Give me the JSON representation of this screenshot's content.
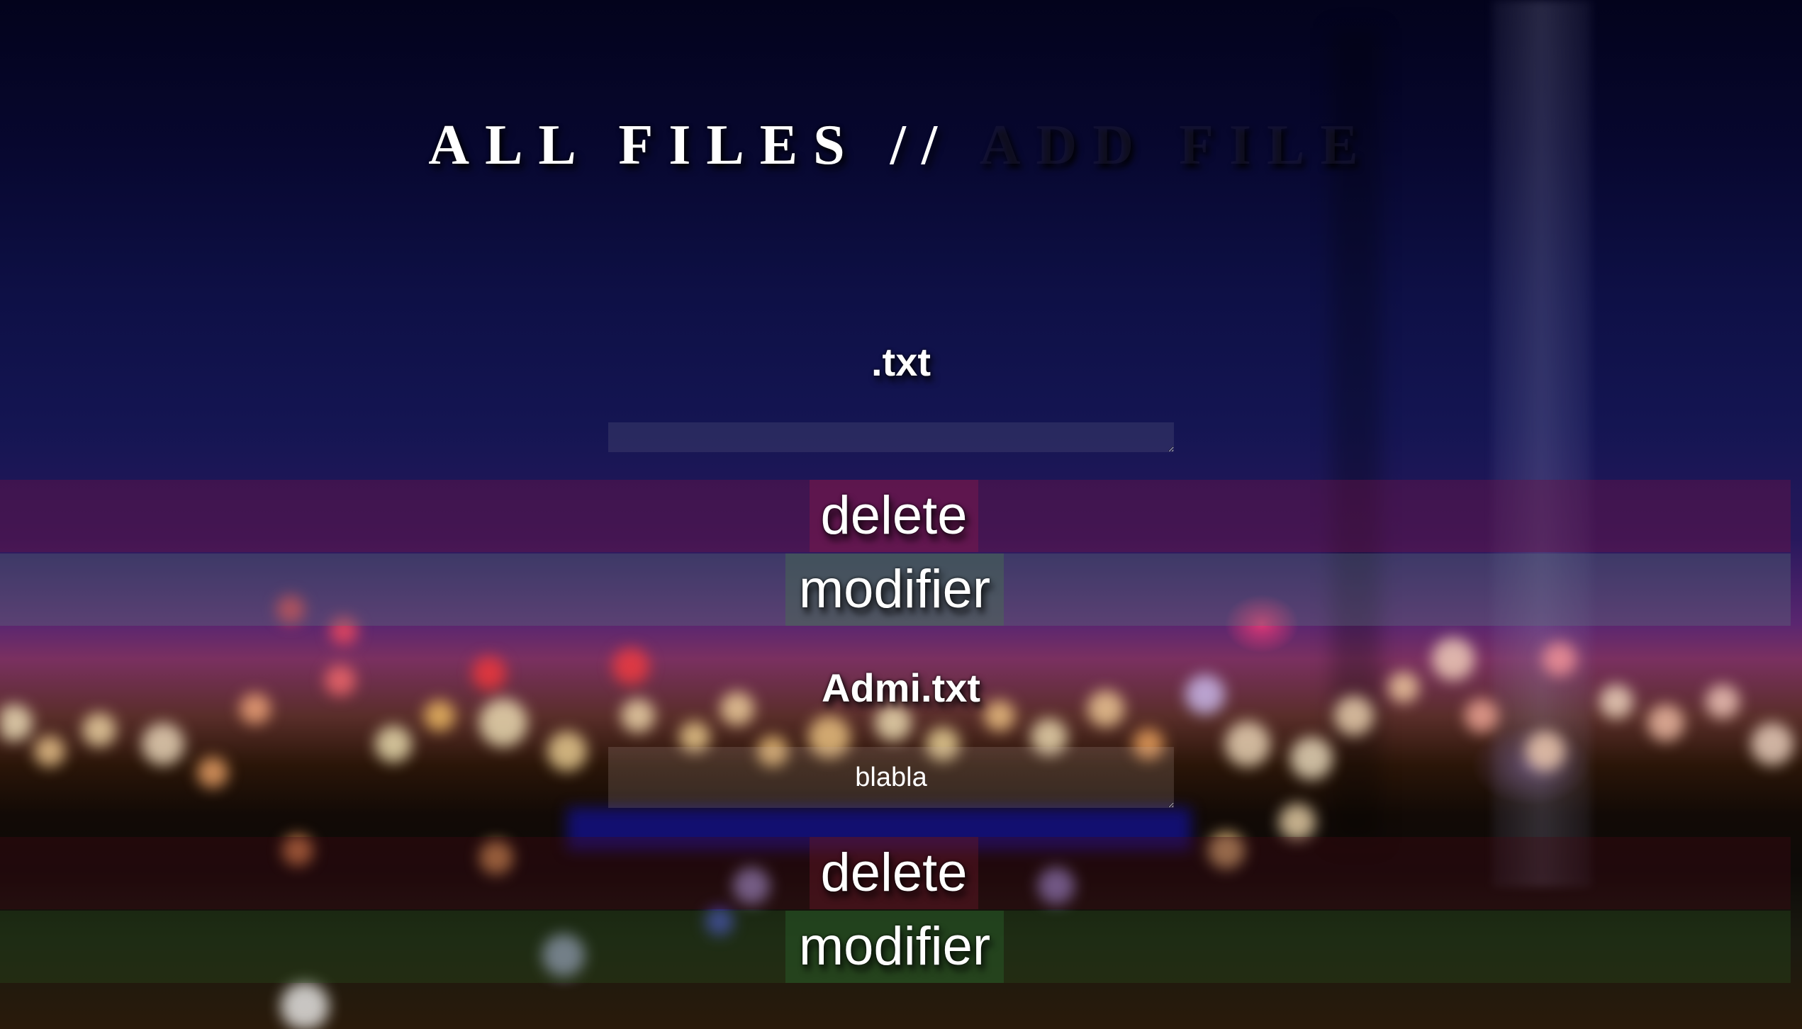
{
  "nav": {
    "all_files": "ALL FILES",
    "separator": "//",
    "add_file": "ADD FILE"
  },
  "files": [
    {
      "name": ".txt",
      "content": "",
      "delete_label": "delete",
      "modify_label": "modifier"
    },
    {
      "name": "Admi.txt",
      "content": "blabla",
      "delete_label": "delete",
      "modify_label": "modifier"
    }
  ],
  "colors": {
    "text": "#ffffff",
    "delete_band": "#6e1446",
    "modify_band": "#5a7878",
    "background_top": "#03031c"
  }
}
